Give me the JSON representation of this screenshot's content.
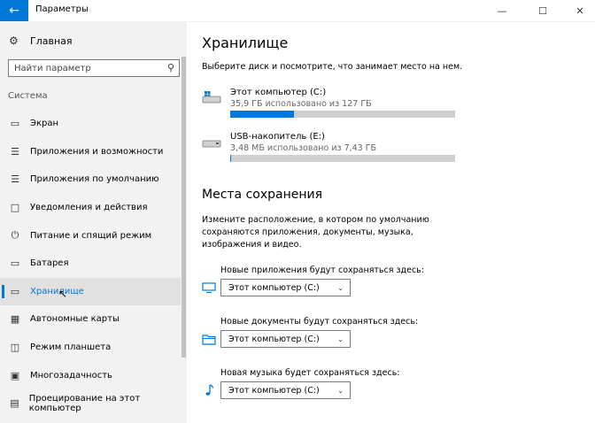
{
  "window": {
    "title": "Параметры",
    "back_icon": "back-arrow-icon",
    "minimize": "—",
    "maximize": "☐",
    "close": "✕"
  },
  "sidebar": {
    "home_label": "Главная",
    "search_placeholder": "Найти параметр",
    "group_label": "Система",
    "items": [
      {
        "label": "Экран",
        "icon": "display-icon"
      },
      {
        "label": "Приложения и возможности",
        "icon": "apps-list-icon"
      },
      {
        "label": "Приложения по умолчанию",
        "icon": "default-apps-icon"
      },
      {
        "label": "Уведомления и действия",
        "icon": "notifications-icon"
      },
      {
        "label": "Питание и спящий режим",
        "icon": "power-icon"
      },
      {
        "label": "Батарея",
        "icon": "battery-icon"
      },
      {
        "label": "Хранилище",
        "icon": "storage-icon",
        "active": true
      },
      {
        "label": "Автономные карты",
        "icon": "offline-maps-icon"
      },
      {
        "label": "Режим планшета",
        "icon": "tablet-mode-icon"
      },
      {
        "label": "Многозадачность",
        "icon": "multitasking-icon"
      },
      {
        "label": "Проецирование на этот компьютер",
        "icon": "projecting-icon"
      }
    ]
  },
  "main": {
    "title": "Хранилище",
    "description": "Выберите диск и посмотрите, что занимает место на нем.",
    "drives": [
      {
        "name": "Этот компьютер (C:)",
        "usage": "35,9 ГБ использовано из 127 ГБ",
        "used_fraction": 0.283,
        "icon": "windows-drive-icon"
      },
      {
        "name": "USB-накопитель (E:)",
        "usage": "3,48 МБ использовано из 7,43 ГБ",
        "used_fraction": 0.0005,
        "icon": "usb-drive-icon"
      }
    ],
    "save_locations": {
      "title": "Места сохранения",
      "description": "Измените расположение, в котором по умолчанию сохраняются приложения, документы, музыка, изображения и видео.",
      "items": [
        {
          "label": "Новые приложения будут сохраняться здесь:",
          "value": "Этот компьютер (C:)",
          "icon": "monitor-icon"
        },
        {
          "label": "Новые документы будут сохраняться здесь:",
          "value": "Этот компьютер (C:)",
          "icon": "folder-icon"
        },
        {
          "label": "Новая музыка будет сохраняться здесь:",
          "value": "Этот компьютер (C:)",
          "icon": "music-note-icon"
        }
      ]
    }
  },
  "colors": {
    "accent": "#0078d7",
    "sidebar_bg": "#f2f2f2",
    "bar_bg": "#cfcfcf"
  }
}
